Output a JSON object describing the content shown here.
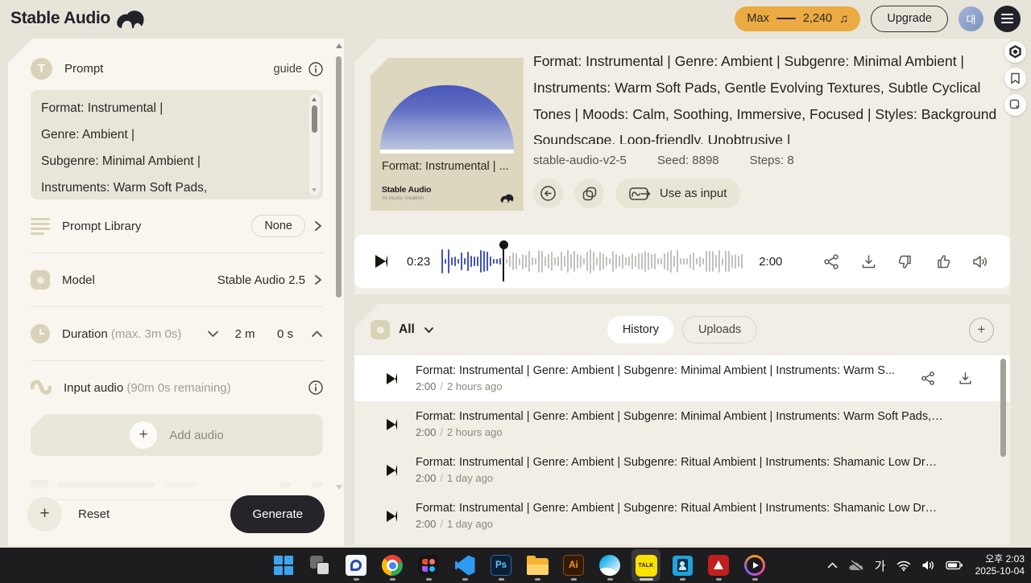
{
  "header": {
    "logo": "Stable Audio",
    "credits": {
      "label": "Max",
      "value": "2,240"
    },
    "upgrade_label": "Upgrade",
    "avatar_text": "대"
  },
  "icons": {
    "note": "♫",
    "plus": "+",
    "t_badge": "T"
  },
  "sidebar": {
    "prompt": {
      "title": "Prompt",
      "guide_label": "guide",
      "lines": [
        "Format: Instrumental |",
        "Genre: Ambient |",
        "Subgenre: Minimal Ambient |",
        "Instruments: Warm Soft Pads,"
      ]
    },
    "prompt_library": {
      "label": "Prompt Library",
      "value": "None"
    },
    "model": {
      "label": "Model",
      "value": "Stable Audio 2.5"
    },
    "duration": {
      "label": "Duration",
      "hint": "(max. 3m 0s)",
      "minutes": "2 m",
      "seconds": "0 s"
    },
    "input_audio": {
      "label": "Input audio",
      "hint": "(90m 0s remaining)",
      "add_label": "Add audio"
    },
    "reset_label": "Reset",
    "generate_label": "Generate"
  },
  "main": {
    "artwork": {
      "caption": "Format: Instrumental | ...",
      "brand": "Stable Audio",
      "brand_sub": "AI music creation"
    },
    "prompt_text": "Format: Instrumental | Genre: Ambient | Subgenre: Minimal Ambient | Instruments: Warm Soft Pads, Gentle Evolving Textures, Subtle Cyclical Tones | Moods: Calm, Soothing, Immersive, Focused | Styles: Background Soundscape, Loop-friendly, Unobtrusive |",
    "meta": {
      "model": "stable-audio-v2-5",
      "seed": "Seed: 8898",
      "steps": "Steps: 8"
    },
    "use_as_input_label": "Use as input",
    "player": {
      "current": "0:23",
      "total": "2:00",
      "progress": 0.2,
      "bar_count": 94,
      "played_color": "#4355bd",
      "rest_color": "#c3c1bd"
    }
  },
  "library": {
    "filter_label": "All",
    "tabs": [
      {
        "label": "History",
        "active": true
      },
      {
        "label": "Uploads",
        "active": false
      }
    ],
    "add_label": "+",
    "meta_separator": "/",
    "tracks": [
      {
        "title": "Format: Instrumental | Genre: Ambient | Subgenre: Minimal Ambient | Instruments: Warm S...",
        "duration": "2:00",
        "age": "2 hours ago",
        "active": true
      },
      {
        "title": "Format: Instrumental | Genre: Ambient | Subgenre: Minimal Ambient | Instruments: Warm Soft Pads, Ge...",
        "duration": "2:00",
        "age": "2 hours ago",
        "active": false
      },
      {
        "title": "Format: Instrumental | Genre: Ambient | Subgenre: Ritual Ambient | Instruments: Shamanic Low Drum, ...",
        "duration": "2:00",
        "age": "1 day ago",
        "active": false
      },
      {
        "title": "Format: Instrumental | Genre: Ambient | Subgenre: Ritual Ambient | Instruments: Shamanic Low Drum, ...",
        "duration": "2:00",
        "age": "1 day ago",
        "active": false
      }
    ]
  },
  "taskbar": {
    "ps_label": "Ps",
    "ai_label": "Ai",
    "talk_label": "TALK",
    "tray": {
      "ime": "가",
      "time": "오후 2:03",
      "date": "2025-10-04"
    }
  }
}
